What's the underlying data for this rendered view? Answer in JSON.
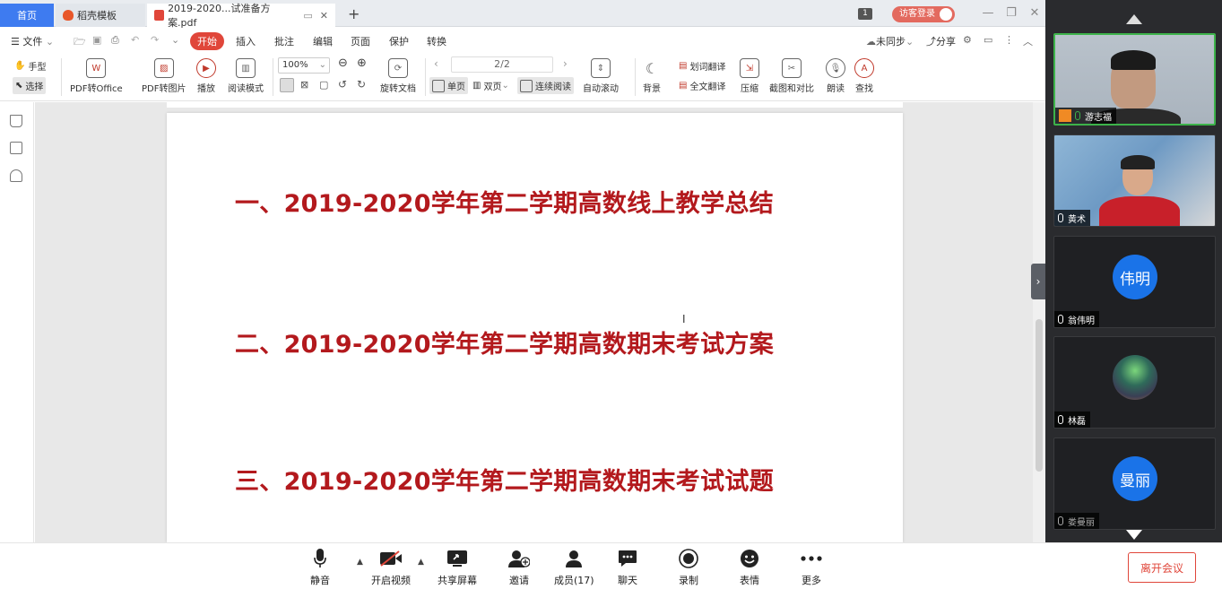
{
  "tabs": {
    "home": "首页",
    "template": "稻壳模板",
    "pdf": "2019-2020...试准备方案.pdf",
    "badge": "1",
    "login": "访客登录"
  },
  "menu": {
    "file": "文件",
    "start": "开始",
    "insert": "插入",
    "annotate": "批注",
    "edit": "编辑",
    "page": "页面",
    "protect": "保护",
    "convert": "转换",
    "sync": "未同步",
    "share": "分享"
  },
  "ribbon": {
    "hand": "手型",
    "select": "选择",
    "pdf_to_office": "PDF转Office",
    "pdf_to_image": "PDF转图片",
    "play": "播放",
    "read_mode": "阅读模式",
    "zoom": "100%",
    "rotate": "旋转文档",
    "page_indicator": "2/2",
    "single_page": "单页",
    "double_page": "双页",
    "continuous": "连续阅读",
    "auto_scroll": "自动滚动",
    "background": "背景",
    "word_translate": "划词翻译",
    "full_translate": "全文翻译",
    "compress": "压缩",
    "screenshot_compare": "截图和对比",
    "read_aloud": "朗读",
    "find": "查找"
  },
  "document": {
    "headings": [
      "一、2019-2020学年第二学期高数线上教学总结",
      "二、2019-2020学年第二学期高数期末考试方案",
      "三、2019-2020学年第二学期高数期末考试试题"
    ]
  },
  "participants": [
    {
      "name": "游志福",
      "type": "video"
    },
    {
      "name": "黄术",
      "type": "video"
    },
    {
      "name": "翁伟明",
      "type": "avatar",
      "avatar_text": "伟明",
      "color": "#1a73e8"
    },
    {
      "name": "林磊",
      "type": "image"
    },
    {
      "name": "娄曼丽",
      "type": "avatar",
      "avatar_text": "曼丽",
      "color": "#1a73e8"
    }
  ],
  "meeting_toolbar": {
    "mute": "静音",
    "start_video": "开启视频",
    "share_screen": "共享屏幕",
    "invite": "邀请",
    "members": "成员(17)",
    "chat": "聊天",
    "record": "录制",
    "reactions": "表情",
    "more": "更多",
    "leave": "离开会议"
  },
  "colors": {
    "accent": "#3e7bf0",
    "heading": "#b3191d",
    "start_tab": "#e0463a",
    "leave": "#e0463a"
  }
}
